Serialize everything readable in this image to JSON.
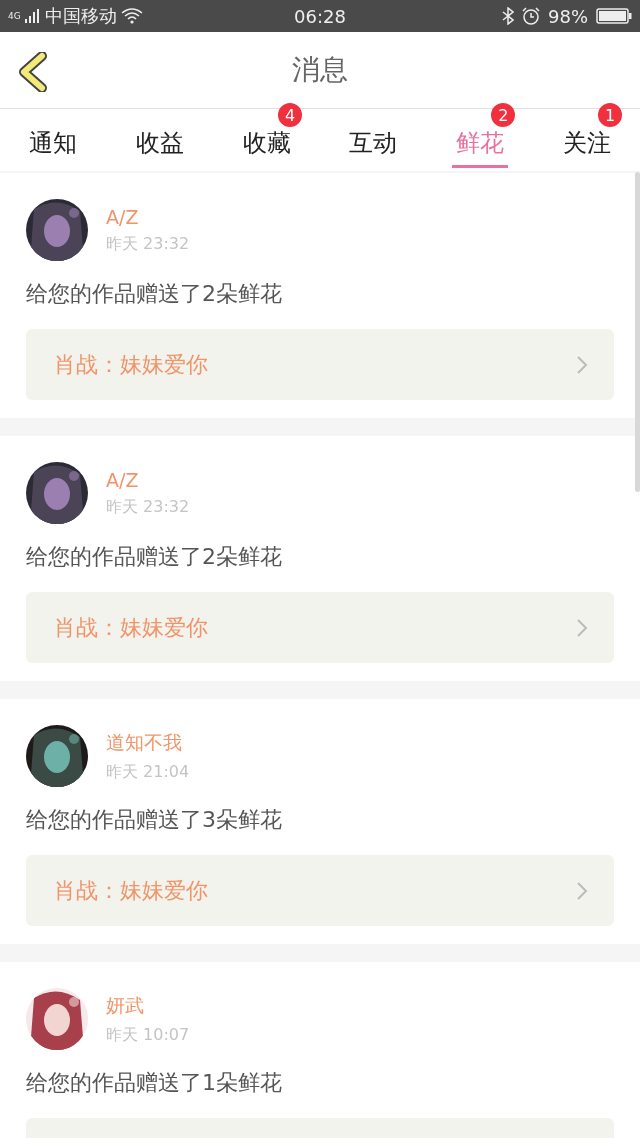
{
  "status_bar": {
    "network": "4G",
    "carrier": "中国移动",
    "time": "06:28",
    "battery": "98%"
  },
  "header": {
    "title": "消息"
  },
  "tabs": [
    {
      "label": "通知",
      "selected": false
    },
    {
      "label": "收益",
      "selected": false
    },
    {
      "label": "收藏",
      "selected": false,
      "badge": "4"
    },
    {
      "label": "互动",
      "selected": false
    },
    {
      "label": "鲜花",
      "selected": true,
      "badge": "2"
    },
    {
      "label": "关注",
      "selected": false,
      "badge": "1"
    }
  ],
  "messages": [
    {
      "name": "A/Z",
      "time": "昨天 23:32",
      "text": "给您的作品赠送了2朵鲜花",
      "work": "肖战：妹妹爱你"
    },
    {
      "name": "A/Z",
      "time": "昨天 23:32",
      "text": "给您的作品赠送了2朵鲜花",
      "work": "肖战：妹妹爱你"
    },
    {
      "name": "道知不我",
      "time": "昨天 21:04",
      "text": "给您的作品赠送了3朵鲜花",
      "work": "肖战：妹妹爱你"
    },
    {
      "name": "妍武",
      "time": "昨天 10:07",
      "text": "给您的作品赠送了1朵鲜花"
    }
  ]
}
